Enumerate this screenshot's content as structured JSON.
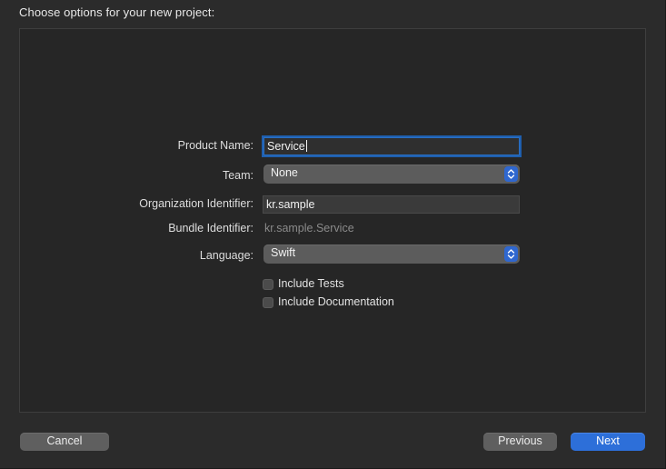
{
  "dialog": {
    "heading": "Choose options for your new project:"
  },
  "form": {
    "product_name": {
      "label": "Product Name:",
      "value": "Service"
    },
    "team": {
      "label": "Team:",
      "value": "None"
    },
    "organization_identifier": {
      "label": "Organization Identifier:",
      "value": "kr.sample"
    },
    "bundle_identifier": {
      "label": "Bundle Identifier:",
      "value": "kr.sample.Service"
    },
    "language": {
      "label": "Language:",
      "value": "Swift"
    },
    "include_tests": {
      "label": "Include Tests",
      "checked": false
    },
    "include_documentation": {
      "label": "Include Documentation",
      "checked": false
    }
  },
  "buttons": {
    "cancel": "Cancel",
    "previous": "Previous",
    "next": "Next"
  },
  "colors": {
    "accent": "#2d6fd9",
    "focus_ring": "#2a6fc4",
    "window_bg": "#2b2b2b",
    "panel_bg": "#262626"
  }
}
